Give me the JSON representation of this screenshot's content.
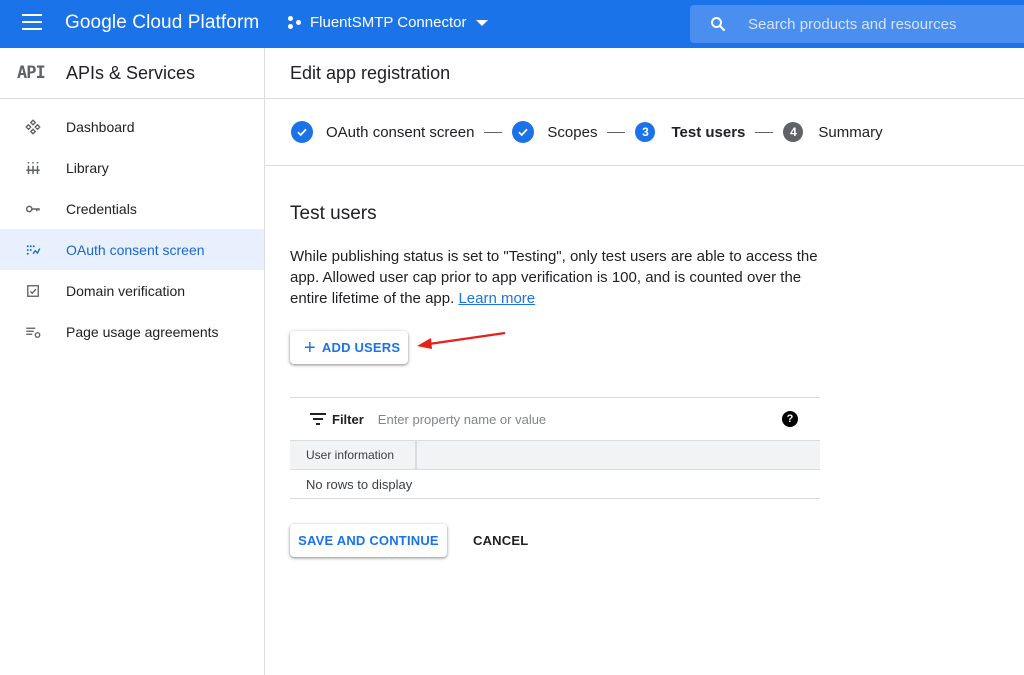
{
  "topbar": {
    "brand": "Google Cloud Platform",
    "project": "FluentSMTP Connector",
    "search_placeholder": "Search products and resources",
    "bg_color": "#1a73e8"
  },
  "sidebar": {
    "logo": "API",
    "title": "APIs & Services",
    "items": [
      {
        "label": "Dashboard",
        "icon": "dashboard-icon"
      },
      {
        "label": "Library",
        "icon": "library-icon"
      },
      {
        "label": "Credentials",
        "icon": "key-icon"
      },
      {
        "label": "OAuth consent screen",
        "icon": "consent-icon",
        "active": true
      },
      {
        "label": "Domain verification",
        "icon": "checkbox-icon"
      },
      {
        "label": "Page usage agreements",
        "icon": "settings-list-icon"
      }
    ]
  },
  "main": {
    "header": "Edit app registration",
    "steps": [
      {
        "label": "OAuth consent screen",
        "state": "done"
      },
      {
        "label": "Scopes",
        "state": "done"
      },
      {
        "number": "3",
        "label": "Test users",
        "state": "current"
      },
      {
        "number": "4",
        "label": "Summary",
        "state": "todo"
      }
    ],
    "section_title": "Test users",
    "description": "While publishing status is set to \"Testing\", only test users are able to access the app. Allowed user cap prior to app verification is 100, and is counted over the entire lifetime of the app.",
    "learn_more": "Learn more",
    "add_users_label": "ADD USERS",
    "table": {
      "filter_label": "Filter",
      "filter_placeholder": "Enter property name or value",
      "help": "?",
      "column": "User information",
      "empty": "No rows to display"
    },
    "save_label": "SAVE AND CONTINUE",
    "cancel_label": "CANCEL"
  }
}
